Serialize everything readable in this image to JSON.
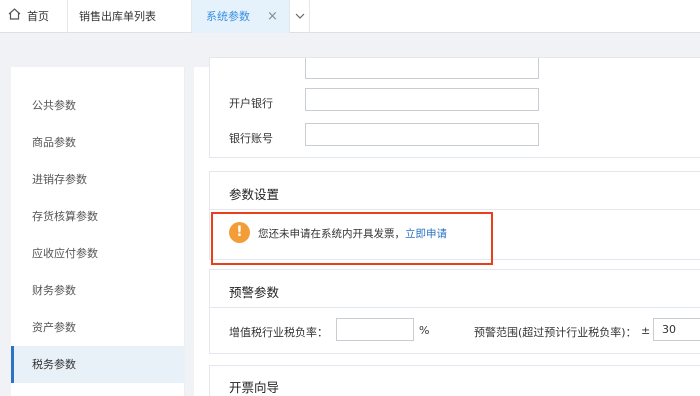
{
  "tabs": {
    "home": "首页",
    "sales_list": "销售出库单列表",
    "active": "系统参数",
    "close_glyph": "×"
  },
  "sidebar": {
    "items": [
      {
        "label": "公共参数"
      },
      {
        "label": "商品参数"
      },
      {
        "label": "进销存参数"
      },
      {
        "label": "存货核算参数"
      },
      {
        "label": "应收应付参数"
      },
      {
        "label": "财务参数"
      },
      {
        "label": "资产参数"
      },
      {
        "label": "税务参数"
      }
    ],
    "active_index": 7
  },
  "bank_section": {
    "bank_label": "开户银行",
    "bank_value": "",
    "account_label": "银行账号",
    "account_value": ""
  },
  "param_section": {
    "title": "参数设置",
    "notice_text": "您还未申请在系统内开具发票，",
    "apply_link": "立即申请"
  },
  "warning_section": {
    "title": "预警参数",
    "vat_label": "增值税行业税负率：",
    "vat_value": "",
    "percent": "%",
    "range_label": "预警范围(超过预计行业税负率)：",
    "plus_minus": "±",
    "range_value": "30"
  },
  "invoice_section": {
    "title": "开票向导"
  },
  "colors": {
    "accent": "#2b73c4",
    "warning": "#f29d38",
    "highlight_border": "#e8401c",
    "active_tab_bg": "#e6f2fb"
  }
}
